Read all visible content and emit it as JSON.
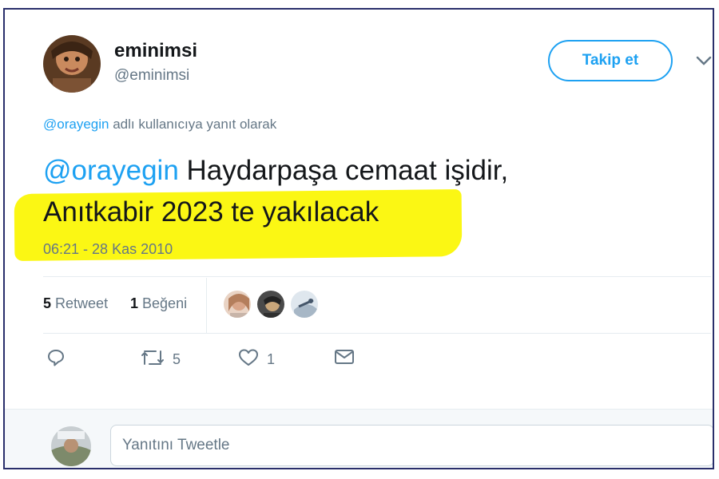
{
  "header": {
    "display_name": "eminimsi",
    "handle": "@eminimsi",
    "follow_label": "Takip et"
  },
  "reply_context": {
    "mention": "@orayegin",
    "text": " adlı kullanıcıya yanıt olarak"
  },
  "tweet": {
    "mention": "@orayegin",
    "line1_rest": " Haydarpaşa cemaat işidir,",
    "line2": "Anıtkabir 2023 te yakılacak",
    "timestamp": "06:21 - 28 Kas 2010"
  },
  "stats": {
    "retweet_count": "5",
    "retweet_label": "Retweet",
    "like_count": "1",
    "like_label": "Beğeni"
  },
  "actions": {
    "retweet_count": "5",
    "like_count": "1"
  },
  "reply_box": {
    "placeholder": "Yanıtını Tweetle"
  },
  "colors": {
    "accent": "#1da1f2",
    "highlight": "#fbf714",
    "muted": "#657786"
  },
  "icons": {
    "reply": "reply-icon",
    "retweet": "retweet-icon",
    "like": "heart-icon",
    "dm": "mail-icon",
    "menu": "chevron-down-icon"
  }
}
